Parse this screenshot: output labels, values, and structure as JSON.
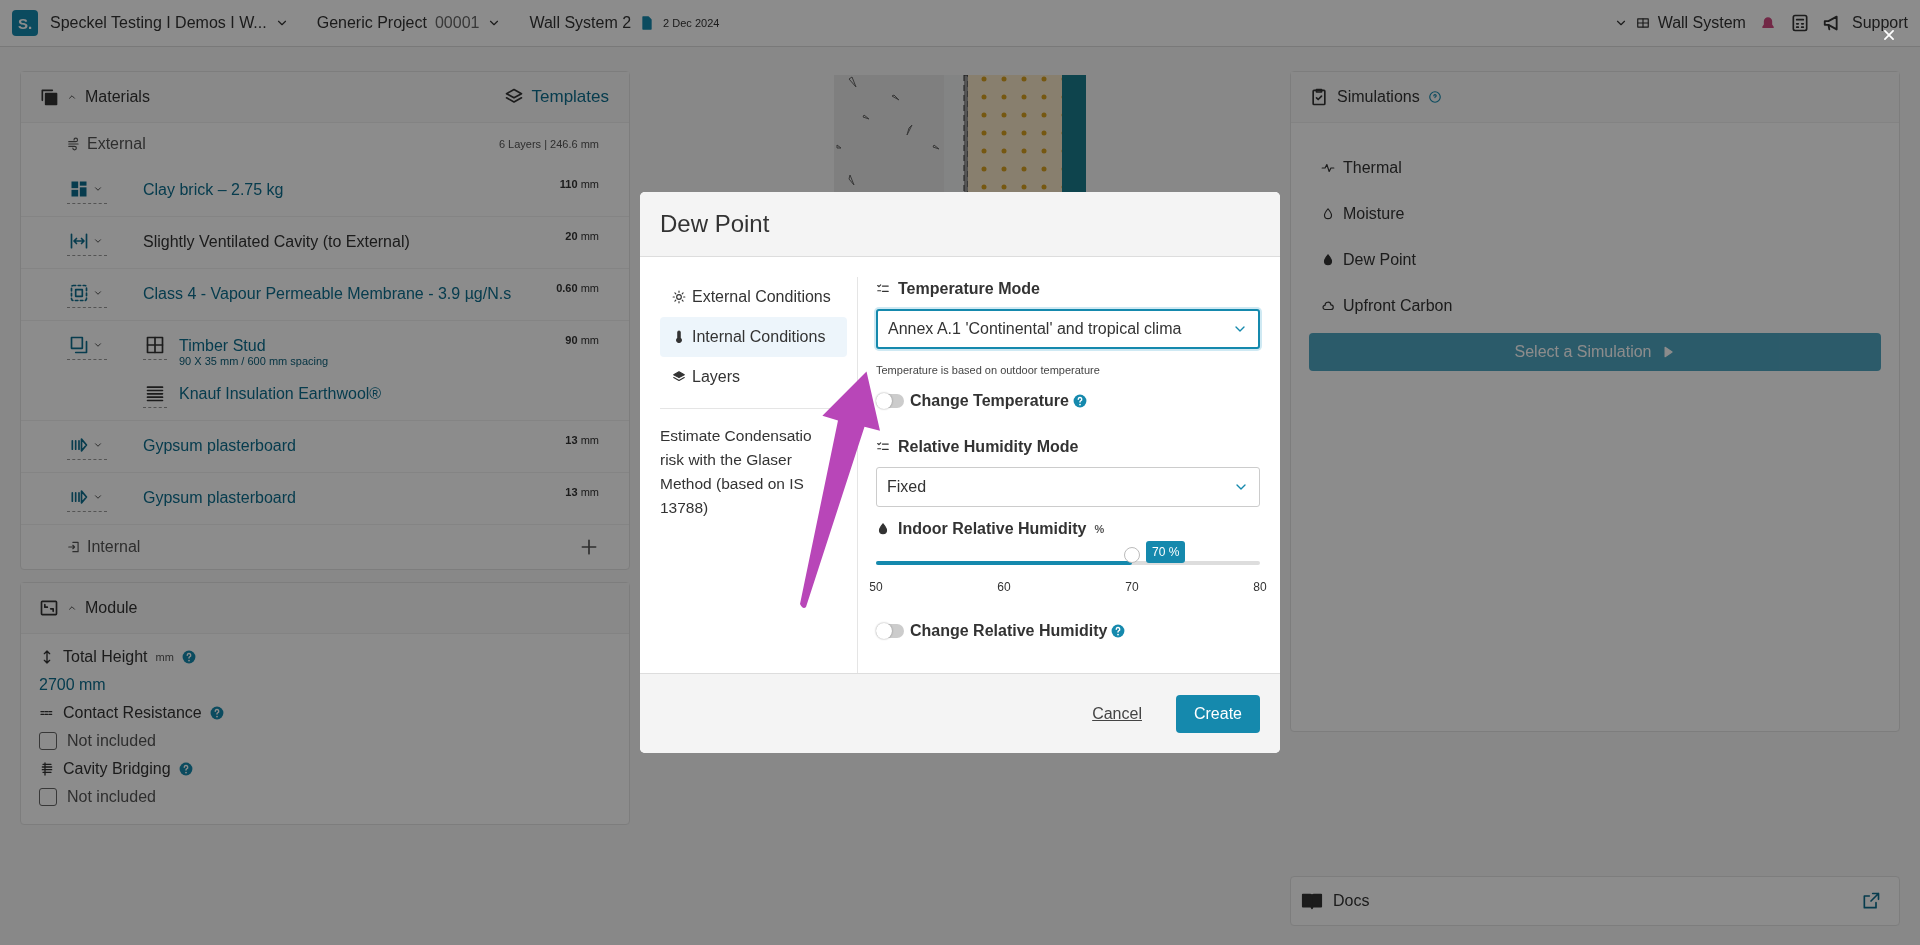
{
  "top_bar": {
    "logo": "S.",
    "workspace": "Speckel Testing I Demos I W...",
    "project": "Generic Project",
    "project_number": "00001",
    "wall": "Wall System 2",
    "date": "2 Dec 2024",
    "view": "Wall System",
    "support": "Support"
  },
  "materials": {
    "title": "Materials",
    "templates": "Templates",
    "external": "External",
    "summary": "6 Layers | 246.6 mm",
    "internal": "Internal",
    "layers": [
      {
        "kind": "brick",
        "thickness": "110",
        "unit": "mm",
        "components": [
          {
            "kind": "material",
            "name": "Clay brick – 2.75 kg"
          }
        ]
      },
      {
        "kind": "cavity",
        "thickness": "20",
        "unit": "mm",
        "components": [
          {
            "kind": "air",
            "name": "Slightly Ventilated Cavity (to External)"
          }
        ]
      },
      {
        "kind": "membrane",
        "thickness": "0.60",
        "unit": "mm",
        "components": [
          {
            "kind": "material",
            "name": "Class 4 - Vapour Permeable Membrane - 3.9 µg/N.s"
          }
        ]
      },
      {
        "kind": "frame",
        "thickness": "90",
        "unit": "mm",
        "components": [
          {
            "kind": "stud",
            "name": "Timber Stud",
            "detail": "90 X 35 mm / 600 mm spacing"
          },
          {
            "kind": "infill",
            "name": "Knauf Insulation Earthwool®"
          }
        ]
      },
      {
        "kind": "board",
        "thickness": "13",
        "unit": "mm",
        "components": [
          {
            "kind": "material",
            "name": "Gypsum plasterboard"
          }
        ]
      },
      {
        "kind": "board",
        "thickness": "13",
        "unit": "mm",
        "components": [
          {
            "kind": "material",
            "name": "Gypsum plasterboard"
          }
        ]
      }
    ]
  },
  "module": {
    "title": "Module",
    "fields": [
      {
        "kind": "height",
        "label": "Total Height",
        "unit": "mm",
        "value": "2700 mm"
      },
      {
        "kind": "contact",
        "label": "Contact Resistance",
        "option": "Not included",
        "checked": false
      },
      {
        "kind": "bridging",
        "label": "Cavity Bridging",
        "option": "Not included",
        "checked": false
      }
    ]
  },
  "simulations": {
    "title": "Simulations",
    "items": [
      {
        "kind": "thermal",
        "label": "Thermal"
      },
      {
        "kind": "moisture",
        "label": "Moisture"
      },
      {
        "kind": "dew",
        "label": "Dew Point"
      },
      {
        "kind": "carbon",
        "label": "Upfront Carbon"
      }
    ],
    "run_button": {
      "label": "Select a Simulation",
      "disabled": true
    },
    "docs": "Docs"
  },
  "dialog": {
    "title": "Dew Point",
    "nav": [
      {
        "kind": "external",
        "label": "External Conditions",
        "selected": false
      },
      {
        "kind": "internal",
        "label": "Internal Conditions",
        "selected": true
      },
      {
        "kind": "layers",
        "label": "Layers",
        "selected": false
      }
    ],
    "description": "Estimate Condensatio risk with the Glaser Method (based on IS 13788)",
    "temperature_mode": {
      "label": "Temperature Mode",
      "value": "Annex A.1 'Continental' and tropical clima",
      "focused": true,
      "hint": "Temperature is based on outdoor temperature"
    },
    "change_temperature": {
      "label": "Change Temperature",
      "on": false
    },
    "humidity_mode": {
      "label": "Relative Humidity Mode",
      "value": "Fixed",
      "focused": false
    },
    "indoor_humidity": {
      "label": "Indoor Relative Humidity",
      "unit": "%",
      "level": 0.6667,
      "reading": "70 %",
      "ticks": [
        "50",
        "60",
        "70",
        "80"
      ]
    },
    "change_humidity": {
      "label": "Change Relative Humidity",
      "on": false
    },
    "cancel": "Cancel",
    "create": "Create"
  }
}
